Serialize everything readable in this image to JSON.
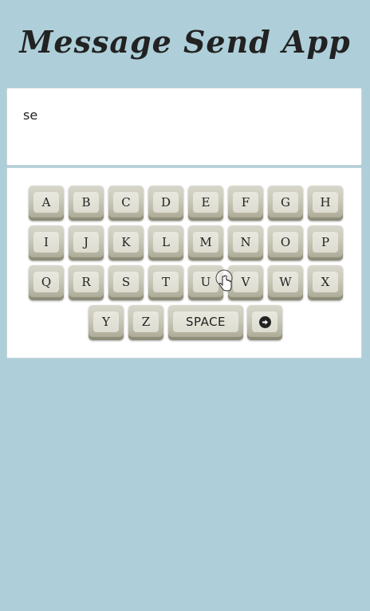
{
  "app": {
    "title": "Message Send App"
  },
  "message": {
    "text": "se"
  },
  "keyboard": {
    "rows": [
      [
        "A",
        "B",
        "C",
        "D",
        "E",
        "F",
        "G",
        "H"
      ],
      [
        "I",
        "J",
        "K",
        "L",
        "M",
        "N",
        "O",
        "P"
      ],
      [
        "Q",
        "R",
        "S",
        "T",
        "U",
        "V",
        "W",
        "X"
      ],
      [
        "Y",
        "Z"
      ]
    ],
    "space_label": "SPACE",
    "send_icon": "arrow-right-circle-icon"
  },
  "colors": {
    "background": "#aecfd9",
    "key": "#c9c8b8",
    "text": "#222222"
  }
}
